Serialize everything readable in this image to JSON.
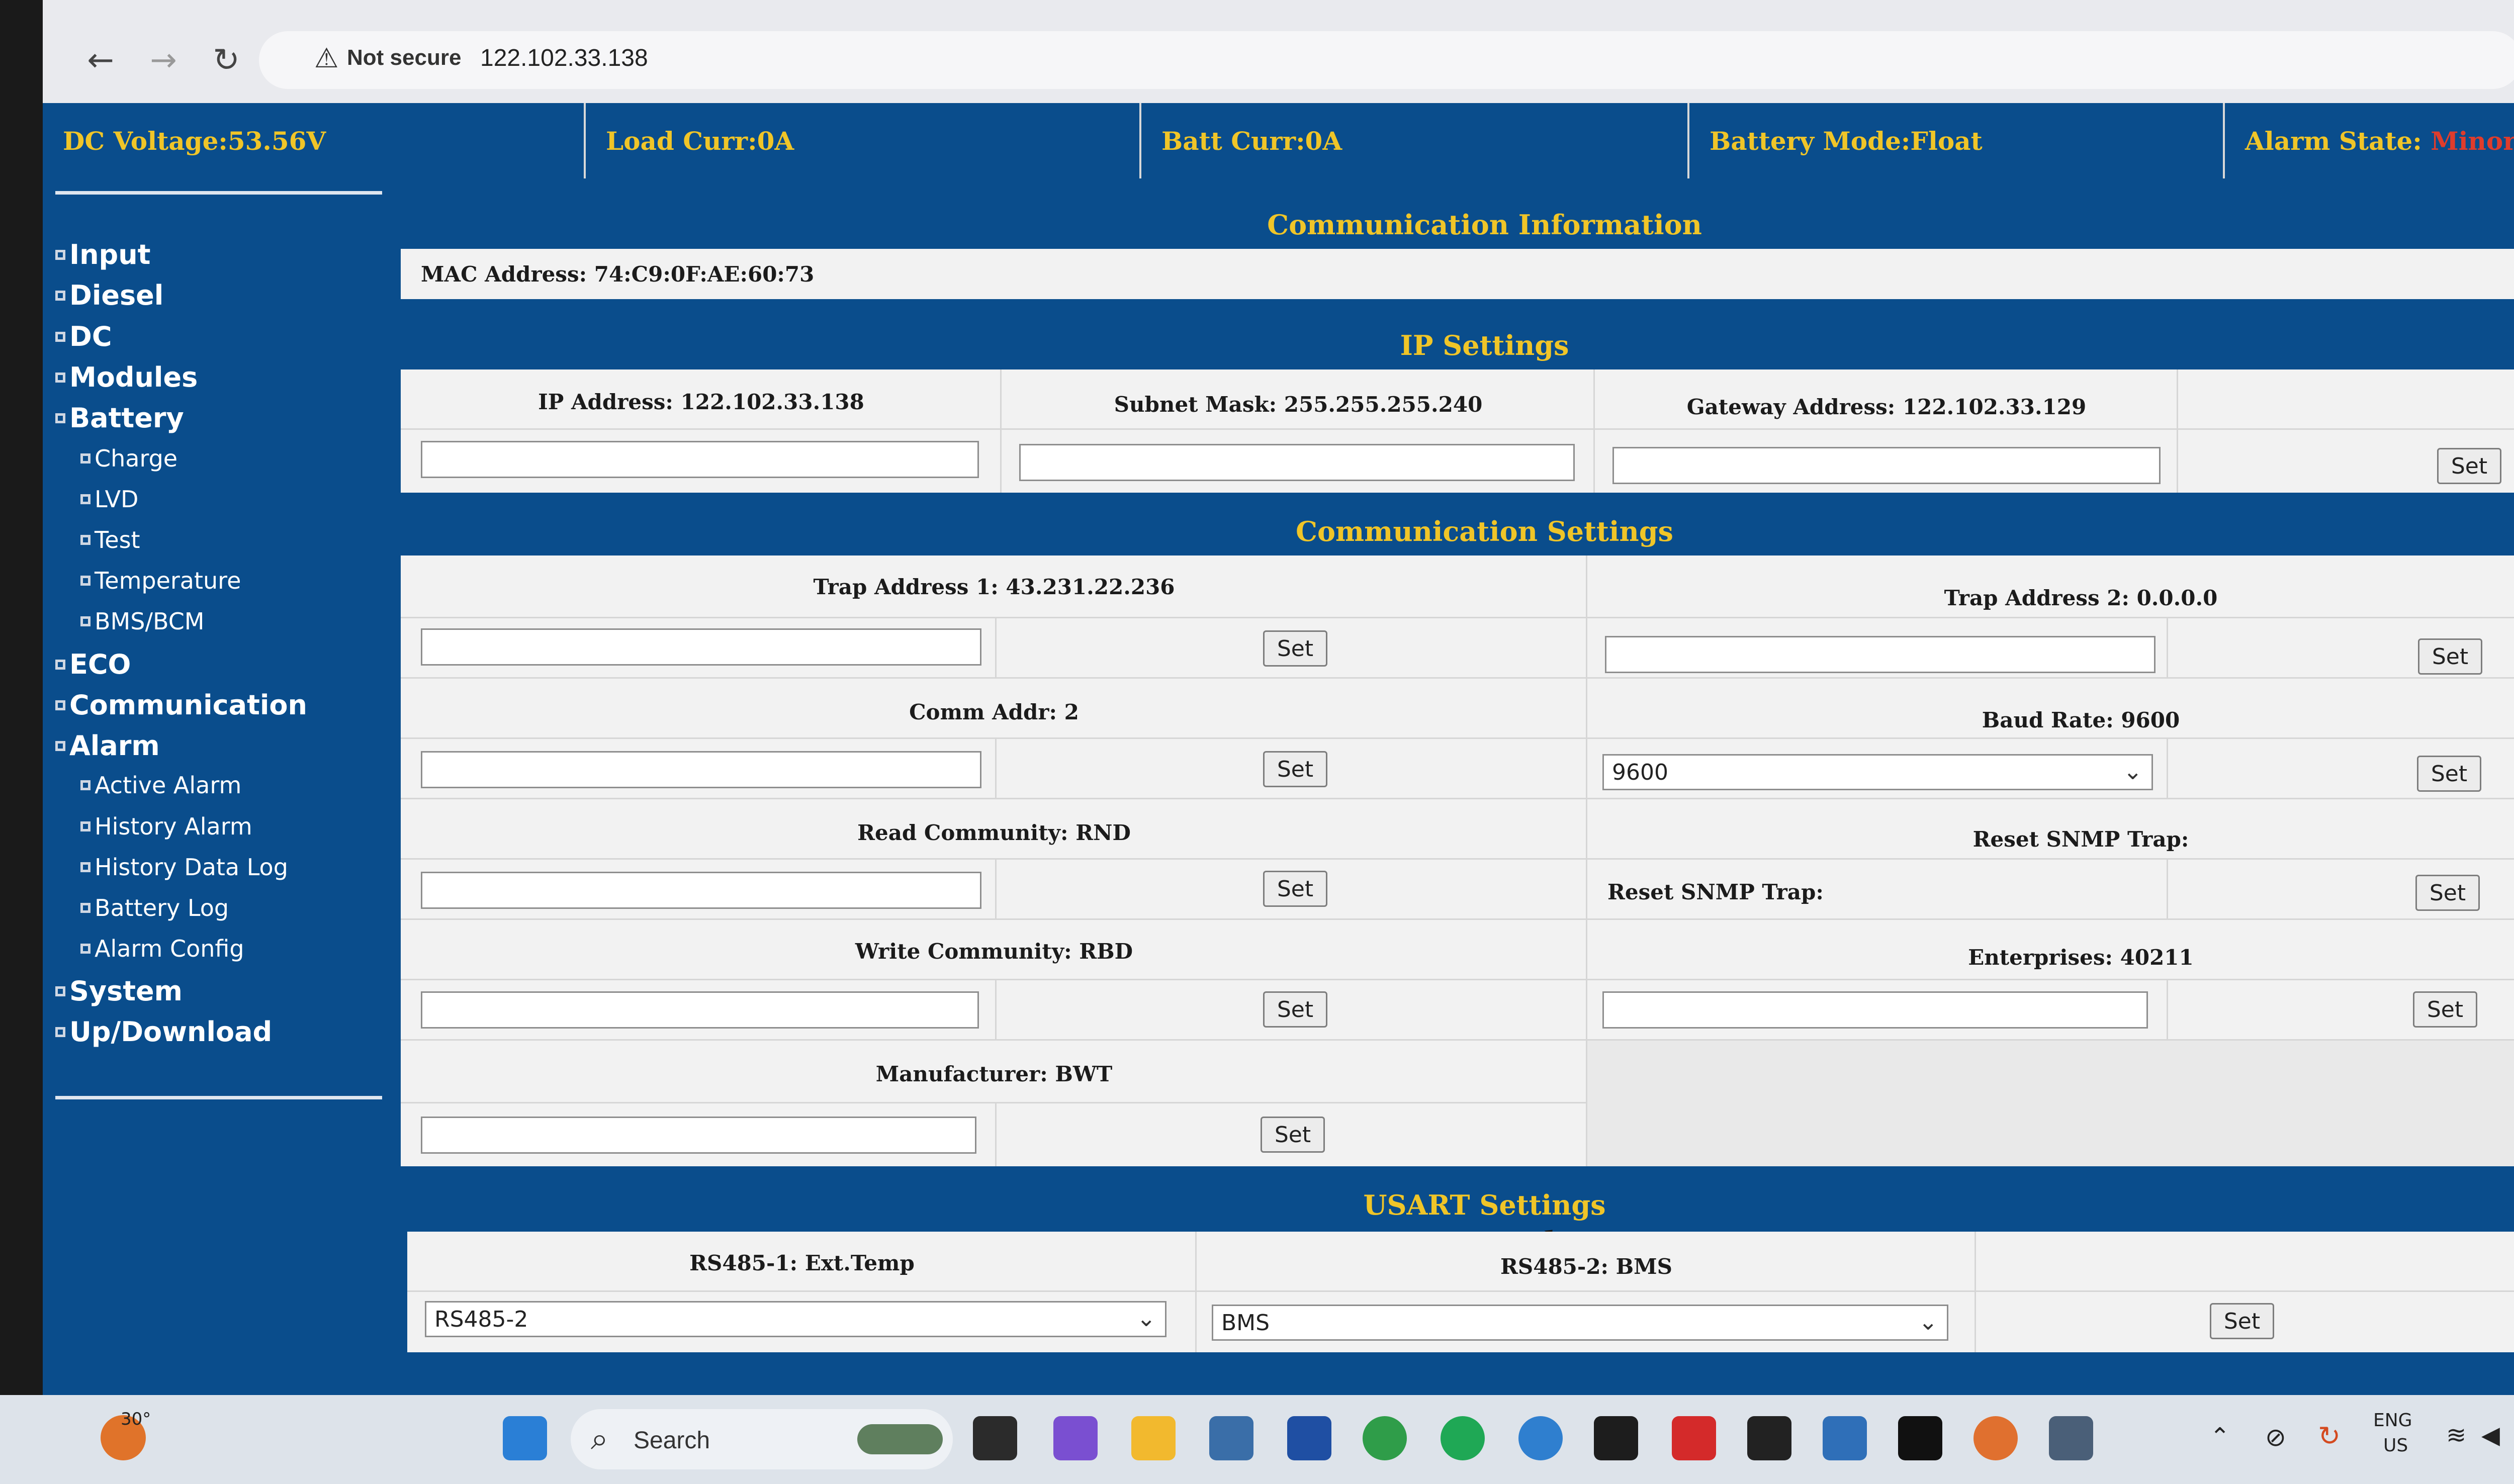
{
  "browser": {
    "back_icon": "back-arrow-icon",
    "forward_icon": "forward-arrow-icon",
    "reload_icon": "reload-icon",
    "security_label": "Not secure",
    "url": "122.102.33.138"
  },
  "status": {
    "dc_voltage": {
      "label": "DC Voltage:",
      "value": "53.56V"
    },
    "load_curr": {
      "label": "Load Curr:",
      "value": "0A"
    },
    "batt_curr": {
      "label": "Batt Curr:",
      "value": "0A"
    },
    "battery_mode": {
      "label": "Battery Mode:",
      "value": "Float"
    },
    "alarm_state": {
      "label": "Alarm State: ",
      "value": "Minor"
    }
  },
  "nav": {
    "items": [
      {
        "label": "Input",
        "level": "top"
      },
      {
        "label": "Diesel",
        "level": "top"
      },
      {
        "label": "DC",
        "level": "top"
      },
      {
        "label": "Modules",
        "level": "top"
      },
      {
        "label": "Battery",
        "level": "top"
      },
      {
        "label": "Charge",
        "level": "sub"
      },
      {
        "label": "LVD",
        "level": "sub"
      },
      {
        "label": "Test",
        "level": "sub"
      },
      {
        "label": "Temperature",
        "level": "sub"
      },
      {
        "label": "BMS/BCM",
        "level": "sub"
      },
      {
        "label": "ECO",
        "level": "top"
      },
      {
        "label": "Communication",
        "level": "top"
      },
      {
        "label": "Alarm",
        "level": "top"
      },
      {
        "label": "Active Alarm",
        "level": "sub"
      },
      {
        "label": "History Alarm",
        "level": "sub"
      },
      {
        "label": "History Data Log",
        "level": "sub"
      },
      {
        "label": "Battery Log",
        "level": "sub"
      },
      {
        "label": "Alarm Config",
        "level": "sub"
      },
      {
        "label": "System",
        "level": "top"
      },
      {
        "label": "Up/Download",
        "level": "top"
      }
    ]
  },
  "comm_info": {
    "title": "Communication Information",
    "mac": "MAC Address: 74:C9:0F:AE:60:73"
  },
  "ip_settings": {
    "title": "IP Settings",
    "ip_label": "IP Address: 122.102.33.138",
    "subnet_label": "Subnet Mask: 255.255.255.240",
    "gateway_label": "Gateway Address: 122.102.33.129",
    "set_label": "Set"
  },
  "comm_settings": {
    "title": "Communication Settings",
    "trap1_label": "Trap Address 1: 43.231.22.236",
    "trap2_label": "Trap Address 2: 0.0.0.0",
    "comm_addr_label": "Comm Addr: 2",
    "baud_label": "Baud Rate: 9600",
    "baud_value": "9600",
    "read_comm_label": "Read Community: RND",
    "reset_snmp_header": "Reset SNMP Trap:",
    "reset_snmp_label": "Reset SNMP Trap:",
    "write_comm_label": "Write Community: RBD",
    "enterprises_label": "Enterprises: 40211",
    "manufacturer_label": "Manufacturer: BWT",
    "set_label": "Set"
  },
  "usart": {
    "title": "USART Settings",
    "rs485_1_label": "RS485-1: Ext.Temp",
    "rs485_2_label": "RS485-2: BMS",
    "rs485_1_value": "RS485-2",
    "rs485_2_value": "BMS",
    "set_label": "Set"
  },
  "taskbar": {
    "weather": "30°",
    "search_placeholder": "Search",
    "lang_top": "ENG",
    "lang_bottom": "US"
  },
  "colors": {
    "page_blue": "#0a4d8c",
    "title_gold": "#f0c528",
    "alarm_red": "#e03c2c"
  }
}
